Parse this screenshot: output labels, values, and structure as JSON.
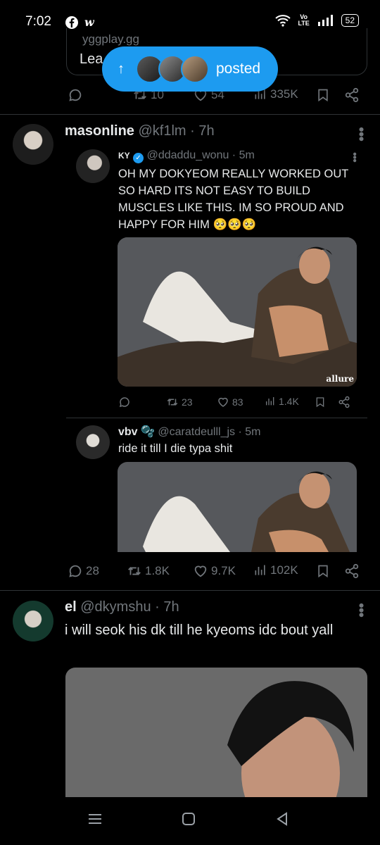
{
  "status": {
    "time": "7:02",
    "app_icons": [
      "facebook-icon",
      "w-app-icon"
    ],
    "volte": "Vo LTE",
    "battery": "52"
  },
  "top_tweet": {
    "card_domain": "yggplay.gg",
    "card_title": "Lea",
    "retweets": "10",
    "likes": "54",
    "views": "335K"
  },
  "new_posts_pill": {
    "label": "posted"
  },
  "tweet1": {
    "name": "masonline",
    "handle": "@kf1lm",
    "time": "7h",
    "quote1": {
      "name": "KY",
      "handle": "@ddaddu_wonu",
      "time": "5m",
      "text": "OH MY DOKYEOM REALLY WORKED OUT SO HARD ITS NOT EASY TO BUILD MUSCLES LIKE THIS. IM SO PROUD AND HAPPY FOR HIM 🥺🥺🥺",
      "watermark": "allure",
      "retweets": "23",
      "likes": "83",
      "views": "1.4K"
    },
    "quote2": {
      "name": "vbv",
      "badge": "🫧",
      "handle": "@caratdeulll_js",
      "time": "5m",
      "text": "ride it till I die typa shit"
    },
    "replies": "28",
    "retweets": "1.8K",
    "likes": "9.7K",
    "views": "102K"
  },
  "tweet2": {
    "name": "el",
    "handle": "@dkymshu",
    "time": "7h",
    "text": "i will seok his dk till he kyeoms idc bout yall"
  },
  "colors": {
    "accent": "#1d9bf0",
    "muted": "#71767b",
    "border": "#2f3336"
  }
}
